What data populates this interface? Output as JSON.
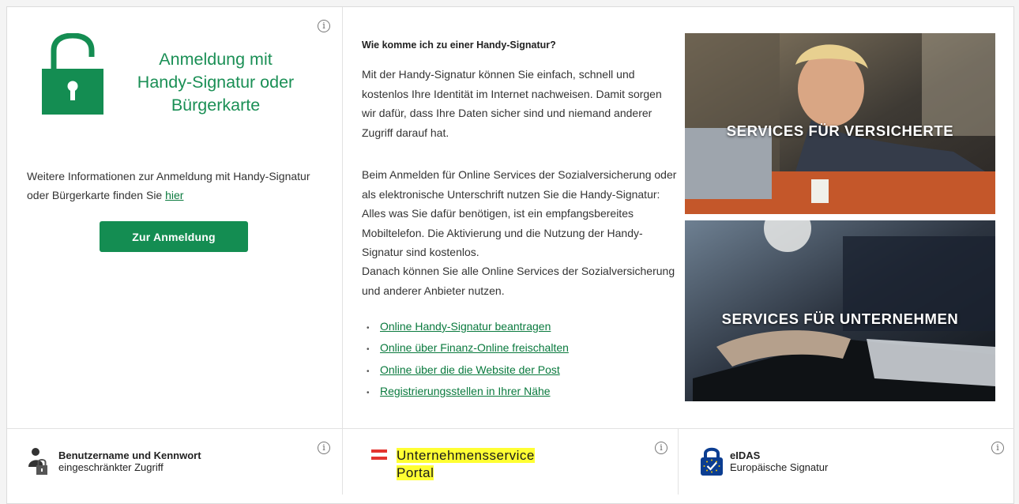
{
  "login": {
    "title_line1": "Anmeldung mit",
    "title_line2": "Handy-Signatur oder",
    "title_line3": "Bürgerkarte",
    "info_text": "Weitere Informationen zur Anmeldung mit Handy-Signatur oder Bürgerkarte finden Sie",
    "info_link": "hier",
    "button_label": "Zur Anmeldung",
    "info_icon": "i"
  },
  "handy": {
    "heading": "Wie komme ich zu einer Handy-Signatur?",
    "paragraph1": "Mit der Handy-Signatur können Sie einfach, schnell und kostenlos Ihre Identität im Internet nachweisen. Damit sorgen wir dafür, dass Ihre Daten sicher sind und niemand anderer Zugriff darauf hat.",
    "paragraph2": "Beim Anmelden für Online Services der Sozialversicherung oder als elektronische Unterschrift nutzen Sie die Handy-Signatur: Alles was Sie dafür benötigen, ist ein empfangsbereites Mobiltelefon. Die Aktivierung und die Nutzung der Handy-Signatur sind kostenlos.",
    "paragraph3": "Danach können Sie alle Online Services der Sozialversicherung und anderer Anbieter nutzen.",
    "links": [
      "Online Handy-Signatur beantragen",
      "Online über Finanz-Online freischalten",
      "Online über die die Website der Post",
      "Registrierungsstellen in Ihrer Nähe"
    ],
    "bullet": "•"
  },
  "tiles": {
    "insured": "SERVICES FÜR VERSICHERTE",
    "companies": "SERVICES FÜR UNTERNEHMEN"
  },
  "bottom": {
    "userpass_title": "Benutzername und Kennwort",
    "userpass_sub": "eingeschränkter Zugriff",
    "usp_line1": "Unternehmensservice",
    "usp_line2": "Portal",
    "eidas_title": "eIDAS",
    "eidas_sub": "Europäische Signatur"
  },
  "icons": [
    "lock-open-icon",
    "info-icon",
    "user-lock-icon",
    "austria-flag-icon",
    "eidas-lock-icon"
  ],
  "colors": {
    "brand_green": "#148d52",
    "link_green": "#0a7a3e",
    "highlight": "#ffff33",
    "eidas_blue": "#0b3d91",
    "eidas_gold": "#f2c300"
  }
}
